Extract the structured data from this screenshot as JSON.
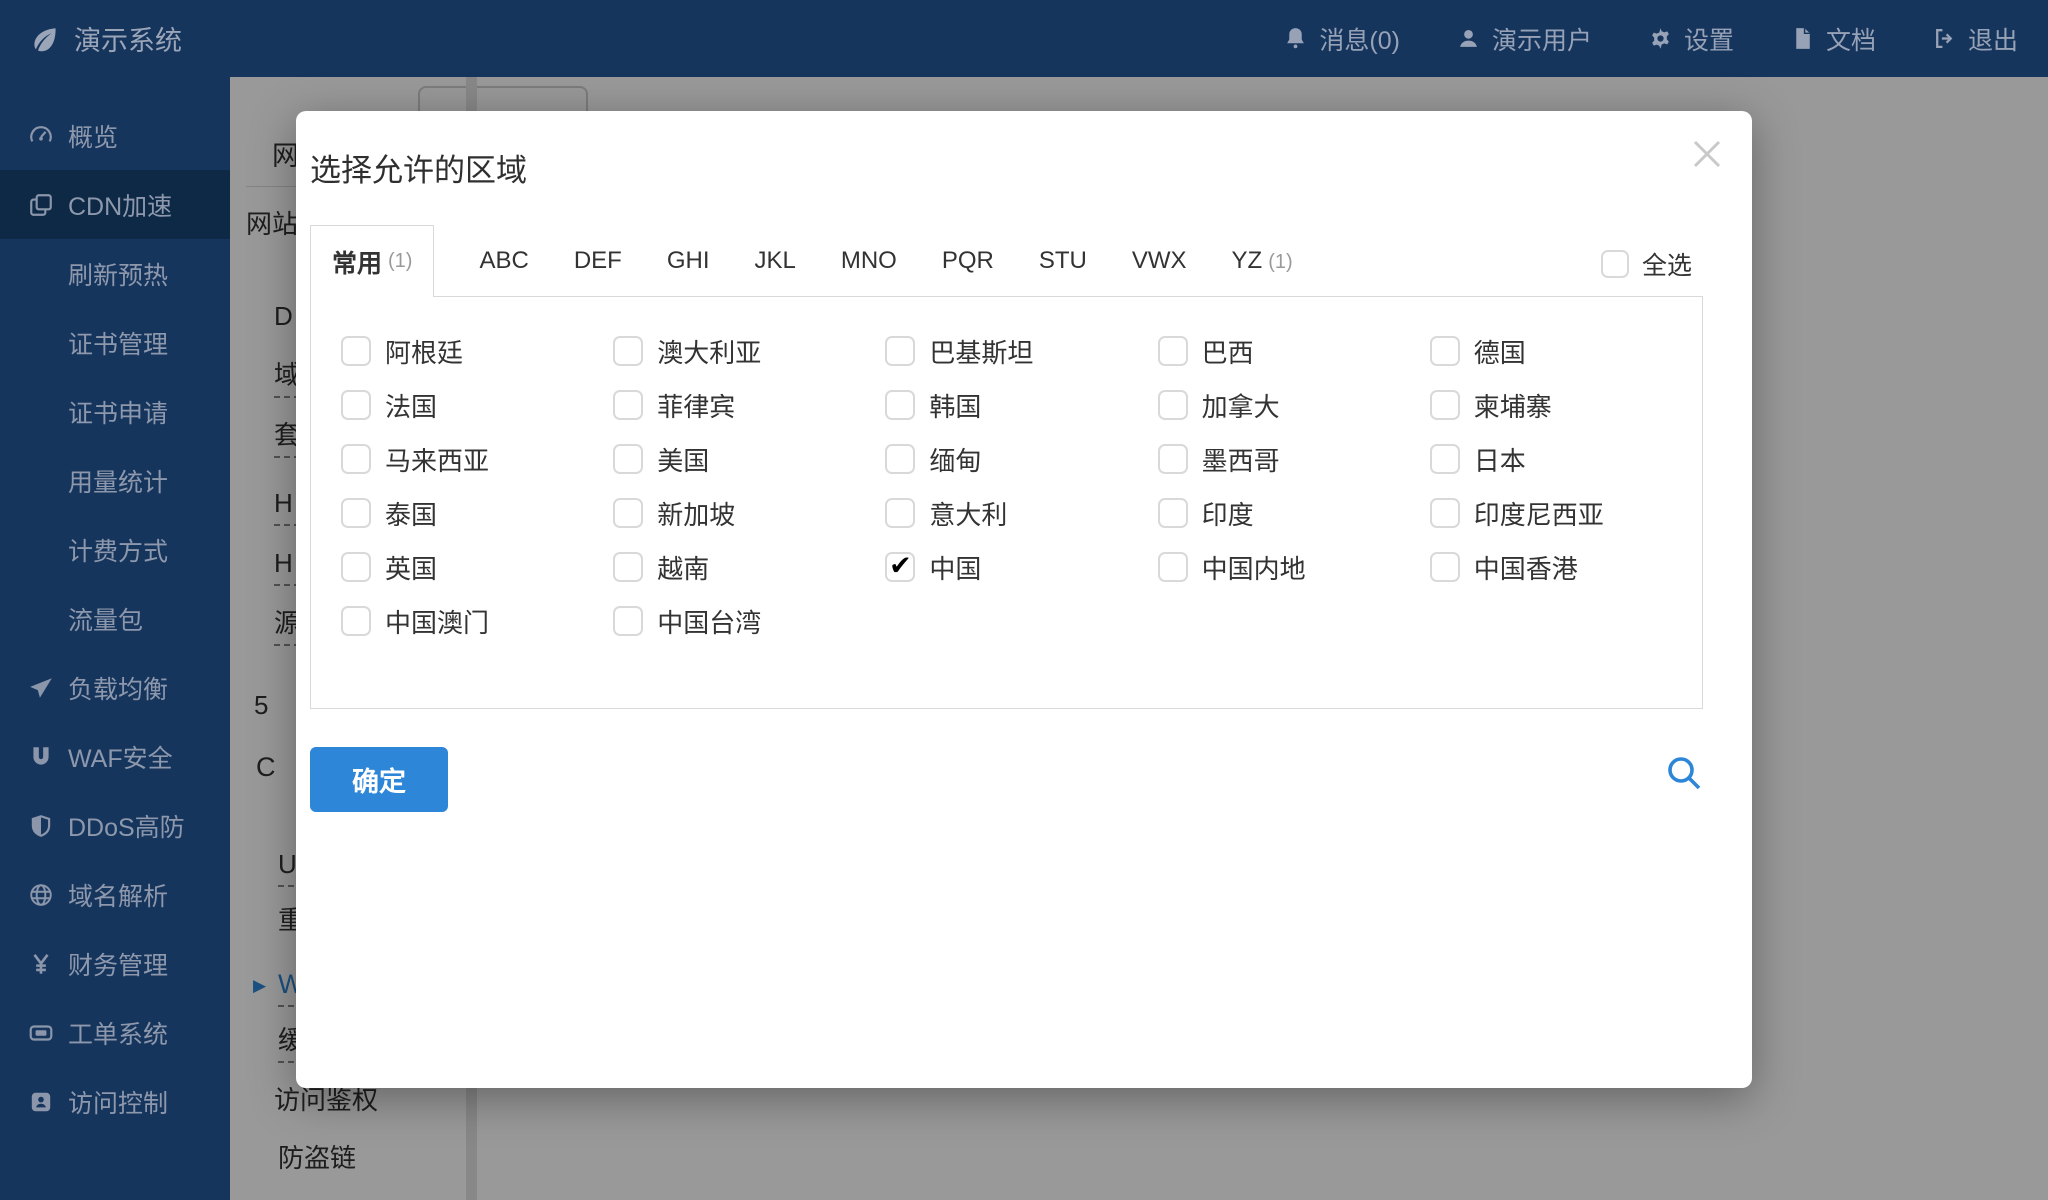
{
  "colors": {
    "navy": "#16355d",
    "navy_active": "#0e2946",
    "accent_blue": "#2d86d8"
  },
  "topbar": {
    "brand": {
      "label": "演示系统",
      "icon": "leaf-icon"
    },
    "items": [
      {
        "icon": "bell-icon",
        "label": "消息(0)"
      },
      {
        "icon": "user-icon",
        "label": "演示用户"
      },
      {
        "icon": "gear-icon",
        "label": "设置"
      },
      {
        "icon": "document-icon",
        "label": "文档"
      },
      {
        "icon": "logout-icon",
        "label": "退出"
      }
    ]
  },
  "sidebar": {
    "items": [
      {
        "icon": "dashboard-icon",
        "label": "概览"
      },
      {
        "icon": "cdn-icon",
        "label": "CDN加速",
        "active": true
      },
      {
        "label": "刷新预热",
        "sub": true
      },
      {
        "label": "证书管理",
        "sub": true
      },
      {
        "label": "证书申请",
        "sub": true
      },
      {
        "label": "用量统计",
        "sub": true
      },
      {
        "label": "计费方式",
        "sub": true
      },
      {
        "label": "流量包",
        "sub": true
      },
      {
        "icon": "paper-plane-icon",
        "label": "负载均衡"
      },
      {
        "icon": "magnet-icon",
        "label": "WAF安全"
      },
      {
        "icon": "shield-icon",
        "label": "DDoS高防"
      },
      {
        "icon": "globe-icon",
        "label": "域名解析"
      },
      {
        "icon": "yen-icon",
        "label": "财务管理"
      },
      {
        "icon": "ticket-icon",
        "label": "工单系统"
      },
      {
        "icon": "id-card-icon",
        "label": "访问控制"
      }
    ]
  },
  "background_page": {
    "fragments": [
      {
        "text": "网",
        "dashed": false,
        "blue": false
      },
      {
        "text": "网站",
        "dashed": false,
        "blue": false
      },
      {
        "text": "D",
        "dashed": false,
        "blue": false
      },
      {
        "text": "域",
        "dashed": true,
        "blue": false
      },
      {
        "text": "套",
        "dashed": true,
        "blue": false
      },
      {
        "text": "H",
        "dashed": true,
        "blue": false
      },
      {
        "text": "H",
        "dashed": true,
        "blue": false
      },
      {
        "text": "源",
        "dashed": true,
        "blue": false
      },
      {
        "text": "5",
        "dashed": false,
        "blue": false
      },
      {
        "text": "C",
        "dashed": false,
        "blue": false
      },
      {
        "text": "U",
        "dashed": true,
        "blue": false
      },
      {
        "text": "重",
        "dashed": false,
        "blue": false
      },
      {
        "text": "▶",
        "dashed": false,
        "blue": true
      },
      {
        "text": "W",
        "dashed": true,
        "blue": true
      },
      {
        "text": "缓",
        "dashed": true,
        "blue": false
      },
      {
        "text": "访问鉴权",
        "dashed": false,
        "blue": false
      },
      {
        "text": "防盗链",
        "dashed": false,
        "blue": false
      }
    ]
  },
  "modal": {
    "title": "选择允许的区域",
    "close_icon": "close-icon",
    "tabs": [
      {
        "label": "常用",
        "count": "(1)",
        "active": true
      },
      {
        "label": "ABC"
      },
      {
        "label": "DEF"
      },
      {
        "label": "GHI"
      },
      {
        "label": "JKL"
      },
      {
        "label": "MNO"
      },
      {
        "label": "PQR"
      },
      {
        "label": "STU"
      },
      {
        "label": "VWX"
      },
      {
        "label": "YZ",
        "count": "(1)"
      }
    ],
    "select_all": {
      "label": "全选",
      "checked": false
    },
    "regions": [
      {
        "label": "阿根廷",
        "checked": false
      },
      {
        "label": "澳大利亚",
        "checked": false
      },
      {
        "label": "巴基斯坦",
        "checked": false
      },
      {
        "label": "巴西",
        "checked": false
      },
      {
        "label": "德国",
        "checked": false
      },
      {
        "label": "法国",
        "checked": false
      },
      {
        "label": "菲律宾",
        "checked": false
      },
      {
        "label": "韩国",
        "checked": false
      },
      {
        "label": "加拿大",
        "checked": false
      },
      {
        "label": "柬埔寨",
        "checked": false
      },
      {
        "label": "马来西亚",
        "checked": false
      },
      {
        "label": "美国",
        "checked": false
      },
      {
        "label": "缅甸",
        "checked": false
      },
      {
        "label": "墨西哥",
        "checked": false
      },
      {
        "label": "日本",
        "checked": false
      },
      {
        "label": "泰国",
        "checked": false
      },
      {
        "label": "新加坡",
        "checked": false
      },
      {
        "label": "意大利",
        "checked": false
      },
      {
        "label": "印度",
        "checked": false
      },
      {
        "label": "印度尼西亚",
        "checked": false
      },
      {
        "label": "英国",
        "checked": false
      },
      {
        "label": "越南",
        "checked": false
      },
      {
        "label": "中国",
        "checked": true
      },
      {
        "label": "中国内地",
        "checked": false
      },
      {
        "label": "中国香港",
        "checked": false
      },
      {
        "label": "中国澳门",
        "checked": false
      },
      {
        "label": "中国台湾",
        "checked": false
      }
    ],
    "confirm_label": "确定",
    "search_icon": "search-icon"
  }
}
